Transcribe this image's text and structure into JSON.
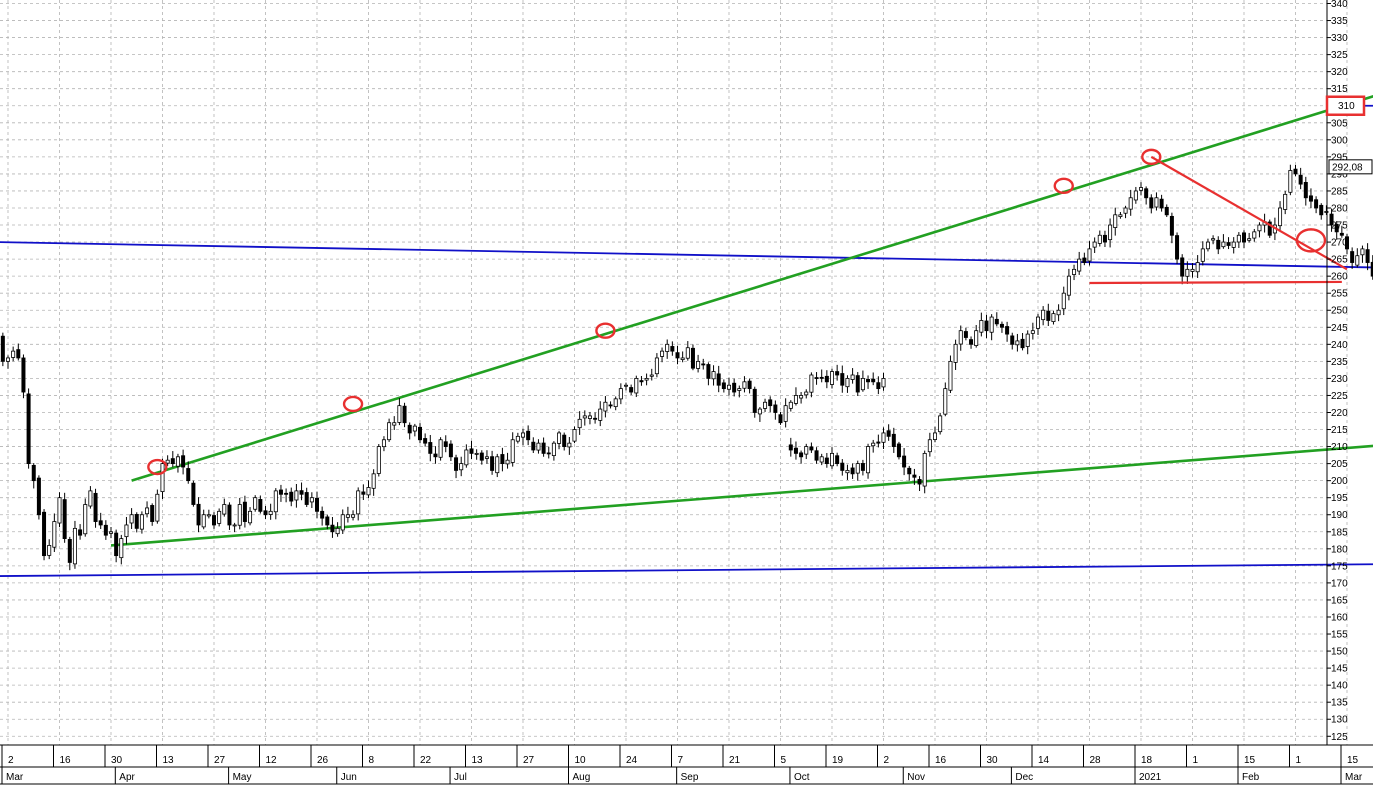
{
  "chart_data": {
    "type": "candlestick",
    "title": "",
    "xlabel": "",
    "ylabel": "",
    "ylim": [
      122,
      341
    ],
    "y_ticks": [
      125,
      130,
      135,
      140,
      145,
      150,
      155,
      160,
      165,
      170,
      175,
      180,
      185,
      190,
      195,
      200,
      205,
      210,
      215,
      220,
      225,
      230,
      235,
      240,
      245,
      250,
      255,
      260,
      265,
      270,
      275,
      280,
      285,
      290,
      295,
      300,
      305,
      310,
      315,
      320,
      325,
      330,
      335,
      340
    ],
    "last_price_label": "292,08",
    "target_label": "310",
    "x_ticks_top": [
      "2",
      "16",
      "30",
      "13",
      "27",
      "12",
      "26",
      "8",
      "22",
      "13",
      "27",
      "10",
      "24",
      "7",
      "21",
      "5",
      "19",
      "2",
      "16",
      "30",
      "14",
      "28",
      "18",
      "1",
      "15",
      "1",
      "15"
    ],
    "x_ticks_bottom": [
      "Mar",
      "Apr",
      "May",
      "Jun",
      "Jul",
      "Aug",
      "Sep",
      "Oct",
      "Nov",
      "Dec",
      "2021",
      "Feb",
      "Mar"
    ],
    "colors": {
      "grid": "#b4b4b4",
      "candle": "#000000",
      "trendline": "#22a022",
      "support_resistance": "#1010c8",
      "annotation": "#e83030",
      "target_box": "#e83030"
    },
    "trendlines": [
      {
        "x1": "2020-04-03",
        "y1": 200,
        "x2": "2021-03-17",
        "y2": 316
      },
      {
        "x1": "2020-03-30",
        "y1": 181,
        "x2": "2021-03-17",
        "y2": 211
      }
    ],
    "horizontal_lines": [
      {
        "x1": "2020-02-27",
        "y1": 270,
        "x2": "2021-03-10",
        "y2": 262.5
      },
      {
        "x1": "2020-02-27",
        "y1": 172,
        "x2": "2021-03-10",
        "y2": 175.5
      },
      {
        "x1": "2021-02-26",
        "y1": 310,
        "x2": "2021-03-17",
        "y2": 310
      }
    ],
    "red_lines": [
      {
        "x1": "2021-01-06",
        "y1": 295,
        "x2": "2021-02-27",
        "y2": 262
      },
      {
        "x1": "2020-12-20",
        "y1": 258,
        "x2": "2021-02-26",
        "y2": 258.3
      }
    ],
    "red_circles": [
      {
        "date": "2020-04-10",
        "price": 204,
        "large": false
      },
      {
        "date": "2020-06-03",
        "price": 222.5,
        "large": false
      },
      {
        "date": "2020-08-11",
        "price": 244,
        "large": false
      },
      {
        "date": "2020-12-14",
        "price": 286.5,
        "large": false
      },
      {
        "date": "2021-01-06",
        "price": 295,
        "large": false
      },
      {
        "date": "2021-02-18",
        "price": 270.5,
        "large": true
      }
    ],
    "segments": [
      {
        "start": "2020-02-27",
        "gap": true,
        "closes": [
          243,
          235,
          236,
          238,
          236,
          226,
          205,
          200,
          190,
          178,
          181,
          188,
          195,
          183,
          176,
          186,
          184,
          193,
          197,
          188,
          187,
          184,
          185,
          178,
          183,
          187,
          190,
          186,
          190,
          192,
          188,
          196,
          205,
          206,
          205,
          207,
          204,
          200,
          193,
          187,
          190,
          190,
          187,
          191,
          193,
          187,
          187,
          193,
          188,
          191,
          195,
          191,
          190,
          191,
          197,
          196,
          196,
          194,
          197,
          196,
          193,
          195,
          191,
          189,
          187,
          185,
          186,
          190,
          190,
          190,
          197,
          196,
          198,
          202,
          210,
          212,
          217,
          217,
          222,
          217,
          214,
          216,
          212,
          211,
          208,
          207,
          212,
          210,
          207,
          203,
          205,
          209,
          208,
          208,
          206,
          207,
          203,
          207,
          205,
          206,
          212,
          213,
          214,
          212,
          209,
          211,
          208,
          208,
          211,
          214,
          210,
          211,
          215,
          218,
          219,
          219,
          218,
          221,
          223,
          222,
          224,
          227,
          228,
          226,
          230,
          229,
          230,
          231,
          236,
          238,
          240,
          238,
          236,
          236,
          239,
          233,
          235,
          234,
          230,
          232,
          228,
          227,
          228,
          226,
          227,
          229,
          227,
          220,
          221,
          223,
          222,
          220,
          217,
          222,
          223,
          225,
          225,
          226,
          231,
          230,
          230,
          229,
          232,
          231,
          228,
          230,
          231,
          226,
          230,
          229,
          229,
          227,
          230
        ]
      },
      {
        "start": "2020-09-30",
        "gap": false,
        "closes": [
          209,
          208,
          207,
          210,
          209,
          206,
          207,
          205,
          208,
          205,
          203,
          203,
          202,
          205,
          203,
          210,
          211,
          211,
          214,
          213,
          210,
          207,
          204,
          202,
          201,
          199,
          208,
          212,
          214,
          219,
          227,
          235,
          240,
          244,
          242,
          240,
          244,
          247,
          244,
          248,
          246,
          245,
          243,
          240,
          241,
          239,
          243,
          244,
          248,
          250,
          247,
          249,
          250,
          255,
          260,
          262,
          265,
          264,
          268,
          270,
          272,
          270,
          275,
          278,
          278,
          280,
          283,
          285,
          286,
          283,
          280,
          283,
          280,
          278,
          272,
          265,
          260,
          262,
          262,
          264,
          268,
          270,
          271,
          268,
          270,
          269,
          270,
          272,
          270,
          271,
          273,
          275,
          276,
          272,
          275,
          280,
          284,
          291,
          290,
          287,
          283,
          282,
          280,
          278,
          279,
          275,
          273,
          272,
          268,
          264,
          266,
          268,
          264,
          260,
          265,
          265,
          262,
          264,
          262,
          263,
          265,
          262,
          268,
          272,
          275,
          272,
          272,
          268,
          268,
          264,
          264,
          262,
          262,
          268,
          270,
          270,
          271,
          269,
          270,
          269,
          271,
          272,
          270,
          275,
          277,
          278,
          280,
          274,
          276,
          277,
          278,
          283,
          285,
          286,
          285,
          284,
          287,
          292
        ]
      }
    ]
  }
}
